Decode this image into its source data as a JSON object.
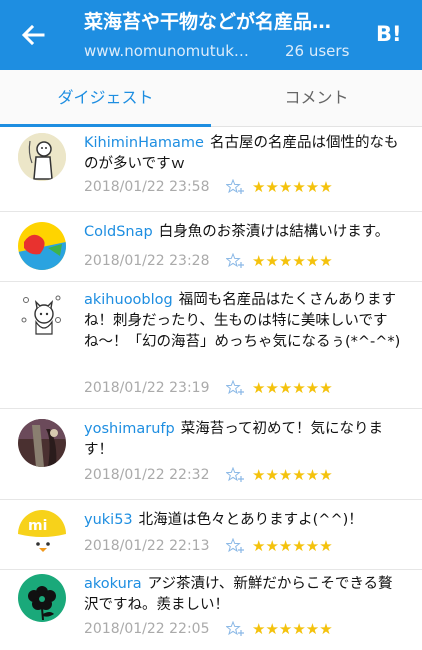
{
  "header": {
    "title": "菜海苔や干物などが名産品…",
    "url": "www.nomunomutuk…",
    "users": "26 users",
    "bookmark_label": "B!"
  },
  "tabs": [
    {
      "label": "ダイジェスト",
      "active": true
    },
    {
      "label": "コメント",
      "active": false
    }
  ],
  "comments": [
    {
      "user": "KihiminHamame",
      "text": "名古屋の名産品は個性的なものが多いですｗ",
      "date": "2018/01/22 23:58",
      "stars": "★★★★★★"
    },
    {
      "user": "ColdSnap",
      "text": "白身魚のお茶漬けは結構いけます。",
      "date": "2018/01/22 23:28",
      "stars": "★★★★★★"
    },
    {
      "user": "akihuooblog",
      "text": "福岡も名産品はたくさんありますね！刺身だったり、生ものは特に美味しいですね〜！「幻の海苔」めっちゃ気になるぅ(*^-^*)",
      "date": "2018/01/22 23:19",
      "stars": "★★★★★★"
    },
    {
      "user": "yoshimarufp",
      "text": "菜海苔って初めて！気になります！",
      "date": "2018/01/22 22:32",
      "stars": "★★★★★★"
    },
    {
      "user": "yuki53",
      "text": "北海道は色々とありますよ(^^)！",
      "date": "2018/01/22 22:13",
      "stars": "★★★★★★"
    },
    {
      "user": "akokura",
      "text": "アジ茶漬け、新鮮だからこそできる贅沢ですね。羨ましい！",
      "date": "2018/01/22 22:05",
      "stars": "★★★★★★"
    }
  ],
  "colors": {
    "accent": "#1e8ee1",
    "star": "#f4c20d"
  },
  "icons": {
    "back": "arrow-left-icon",
    "add_star": "add-star-icon"
  }
}
